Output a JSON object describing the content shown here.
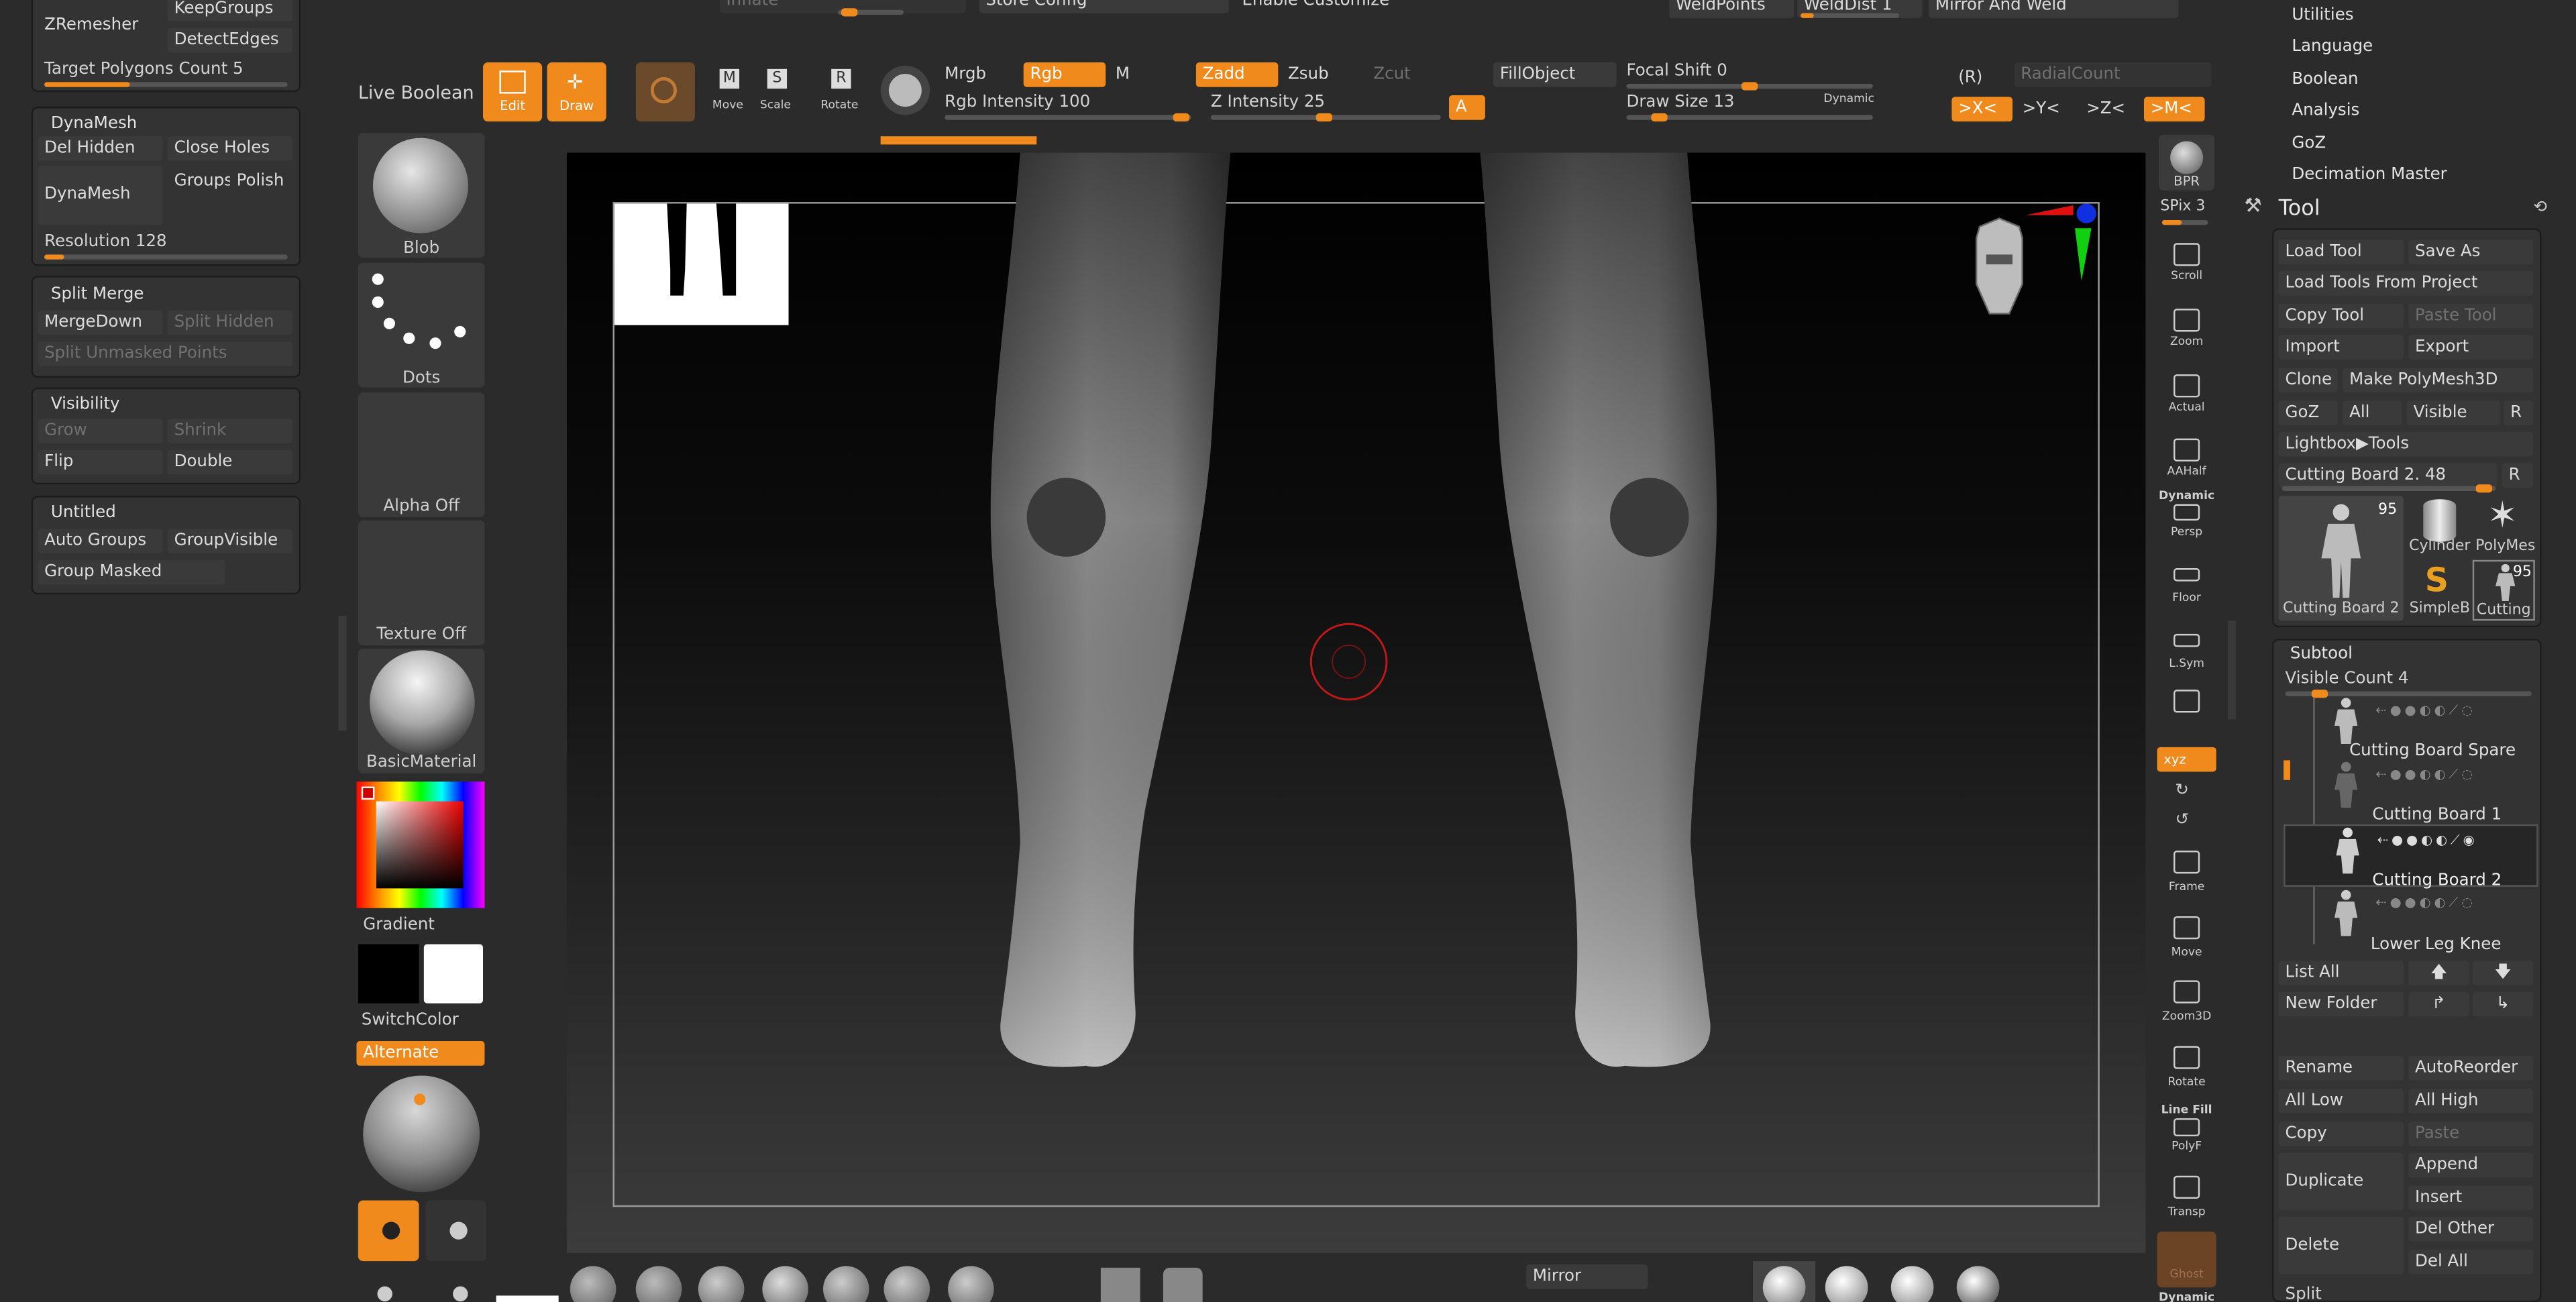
{
  "top_partial": {
    "inflate": "Inflate",
    "store_config": "Store Config",
    "enable_customize": "Enable Customize",
    "weld_points": "WeldPoints",
    "weld_dist": "WeldDist 1",
    "mirror_and_weld": "Mirror And Weld"
  },
  "left_panels": {
    "zremesher": {
      "zremesher": "ZRemesher",
      "keep_groups": "KeepGroups",
      "detect_edges": "DetectEdges",
      "target_polygons": "Target Polygons Count 5",
      "target_level": 0.35
    },
    "dynamesh": {
      "title": "DynaMesh",
      "del_hidden": "Del Hidden",
      "close_holes": "Close Holes",
      "groups": "Groups",
      "polish": "Polish",
      "dynamesh": "DynaMesh",
      "resolution": "Resolution 128",
      "resolution_level": 0.08
    },
    "split_merge": {
      "title": "Split Merge",
      "merge_down": "MergeDown",
      "split_hidden": "Split Hidden",
      "split_unmasked": "Split Unmasked Points"
    },
    "visibility": {
      "title": "Visibility",
      "grow": "Grow",
      "shrink": "Shrink",
      "flip": "Flip",
      "double": "Double"
    },
    "untitled": {
      "title": "Untitled",
      "auto_groups": "Auto Groups",
      "group_visible": "GroupVisible",
      "group_masked": "Group Masked"
    }
  },
  "tool_column": {
    "live_boolean": "Live Boolean",
    "brush": "Blob",
    "stroke": "Dots",
    "alpha": "Alpha Off",
    "texture": "Texture Off",
    "material": "BasicMaterial",
    "gradient": "Gradient",
    "switch_color": "SwitchColor",
    "alternate": "Alternate",
    "main_color": "#000000",
    "secondary_color": "#ffffff"
  },
  "toolbar": {
    "edit": "Edit",
    "draw": "Draw",
    "move": "Move",
    "scale": "Scale",
    "rotate": "Rotate",
    "mrgb": "Mrgb",
    "rgb": "Rgb",
    "m": "M",
    "rgb_intensity": "Rgb Intensity 100",
    "rgb_intensity_level": 1.0,
    "zadd": "Zadd",
    "zsub": "Zsub",
    "zcut": "Zcut",
    "z_intensity": "Z Intensity 25",
    "z_intensity_level": 0.25,
    "a": "A",
    "fill_object": "FillObject",
    "focal_shift": "Focal Shift 0",
    "focal_level": 0.5,
    "draw_size": "Draw Size 13",
    "draw_size_level": 0.08,
    "dynamic": "Dynamic",
    "r_label": "(R)",
    "radial_count": "RadialCount",
    "sym_x": ">X<",
    "sym_y": ">Y<",
    "sym_z": ">Z<",
    "sym_m": ">M<"
  },
  "right_shelf": {
    "bpr": "BPR",
    "spix": "SPix 3",
    "scroll": "Scroll",
    "zoom": "Zoom",
    "actual": "Actual",
    "aahalf": "AAHalf",
    "dynamic": "Dynamic",
    "persp": "Persp",
    "floor": "Floor",
    "lsym": "L.Sym",
    "xyz": "xyz",
    "frame": "Frame",
    "move": "Move",
    "zoom3d": "Zoom3D",
    "rotate": "Rotate",
    "line_fill": "Line Fill",
    "polyf": "PolyF",
    "transp": "Transp",
    "ghost": "Ghost",
    "dynamic2": "Dynamic"
  },
  "menu": {
    "items": [
      "Utilities",
      "Language",
      "Boolean",
      "Analysis",
      "GoZ",
      "Decimation Master"
    ]
  },
  "tool_palette": {
    "title": "Tool",
    "load_tool": "Load Tool",
    "save_as": "Save As",
    "load_from_project": "Load Tools From Project",
    "copy_tool": "Copy Tool",
    "paste_tool": "Paste Tool",
    "import": "Import",
    "export": "Export",
    "clone": "Clone",
    "make_polymesh": "Make PolyMesh3D",
    "goz": "GoZ",
    "all": "All",
    "visible": "Visible",
    "r": "R",
    "lightbox_tools": "Lightbox▶Tools",
    "current_tool": "Cutting Board 2. 48",
    "current_tool_level": 0.94,
    "thumbs": [
      {
        "label": "Cutting Board 2",
        "count": "95"
      },
      {
        "label": "Cylinder"
      },
      {
        "label": "PolyMes"
      },
      {
        "label": "SimpleB"
      },
      {
        "label": "Cutting",
        "count": "95"
      }
    ],
    "subtool_title": "Subtool",
    "visible_count": "Visible Count 4",
    "subtools": [
      "Cutting Board Spare",
      "Cutting Board 1",
      "Cutting Board 2",
      "Lower Leg Knee"
    ],
    "list_all": "List All",
    "new_folder": "New Folder",
    "rename": "Rename",
    "auto_reorder": "AutoReorder",
    "all_low": "All Low",
    "all_high": "All High",
    "copy": "Copy",
    "paste": "Paste",
    "duplicate": "Duplicate",
    "append": "Append",
    "insert": "Insert",
    "delete": "Delete",
    "del_other": "Del Other",
    "del_all": "Del All",
    "split": "Split"
  },
  "bottom": {
    "mirror": "Mirror"
  }
}
